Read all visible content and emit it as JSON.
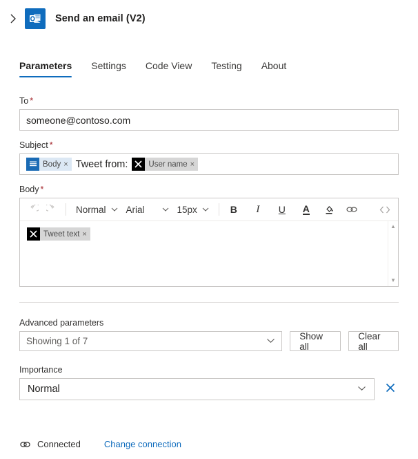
{
  "header": {
    "expand_icon": "chevron-right-icon",
    "app_icon": "outlook-icon",
    "title": "Send an email (V2)"
  },
  "tabs": [
    {
      "label": "Parameters",
      "active": true
    },
    {
      "label": "Settings",
      "active": false
    },
    {
      "label": "Code View",
      "active": false
    },
    {
      "label": "Testing",
      "active": false
    },
    {
      "label": "About",
      "active": false
    }
  ],
  "fields": {
    "to": {
      "label": "To",
      "required": "*",
      "value": "someone@contoso.com"
    },
    "subject": {
      "label": "Subject",
      "required": "*",
      "tokens": [
        {
          "type": "chip",
          "icon": "body-lines-icon",
          "icon_style": "blue",
          "chip_style": "blue",
          "text": "Body",
          "remove": "×"
        },
        {
          "type": "text",
          "text": "Tweet from:"
        },
        {
          "type": "chip",
          "icon": "x-twitter-icon",
          "icon_style": "black",
          "chip_style": "grey",
          "text": "User name",
          "remove": "×"
        }
      ]
    },
    "body": {
      "label": "Body",
      "required": "*",
      "toolbar": {
        "undo": "undo-icon",
        "redo": "redo-icon",
        "style_dropdown": "Normal",
        "font_dropdown": "Arial",
        "size_dropdown": "15px",
        "bold": "B",
        "italic": "I",
        "underline": "U",
        "font_color": "A",
        "highlight": "highlight-icon",
        "link": "link-icon",
        "code": "‹›"
      },
      "tokens": [
        {
          "type": "chip",
          "icon": "x-twitter-icon",
          "icon_style": "black",
          "chip_style": "grey",
          "text": "Tweet text",
          "remove": "×"
        }
      ],
      "scroll_up": "▲",
      "scroll_down": "▼"
    }
  },
  "advanced": {
    "label": "Advanced parameters",
    "select_value": "Showing 1 of 7",
    "show_all_label": "Show all",
    "clear_all_label": "Clear all"
  },
  "importance": {
    "label": "Importance",
    "value": "Normal",
    "clear_icon": "close-icon"
  },
  "footer": {
    "status_icon": "link-chain-icon",
    "status_label": "Connected",
    "change_link": "Change connection"
  },
  "colors": {
    "accent": "#0f6cbd",
    "required": "#a4262c",
    "chip_blue_bg": "#dce8f4",
    "chip_grey_bg": "#d6d6d6",
    "border": "#c8c6c4"
  }
}
